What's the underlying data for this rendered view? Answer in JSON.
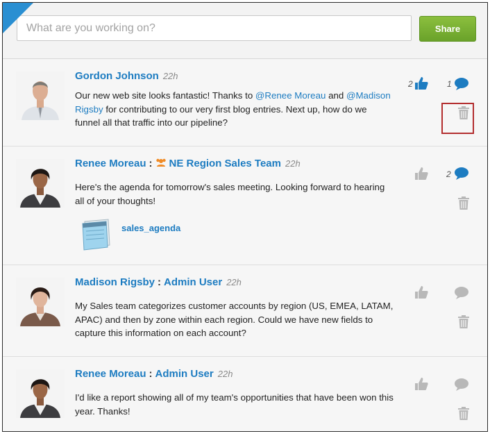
{
  "composer": {
    "placeholder": "What are you working on?",
    "share_label": "Share"
  },
  "posts": [
    {
      "author": "Gordon Johnson",
      "time": "22h",
      "group": "",
      "text_parts": [
        "Our new web site looks fantastic!  Thanks to ",
        "@Renee Moreau",
        " and ",
        "@Madison Rigsby",
        " for contributing to our very first blog entries.  Next up, how do we funnel all that traffic into our pipeline?"
      ],
      "likes": "2",
      "comments": "1"
    },
    {
      "author": "Renee Moreau",
      "time": "22h",
      "group": "NE Region Sales Team",
      "text": "Here's the agenda for tomorrow's sales meeting.  Looking forward to hearing all of your thoughts!",
      "attachment": "sales_agenda",
      "comments": "2"
    },
    {
      "author": "Madison Rigsby",
      "time": "22h",
      "group": "Admin User",
      "text": "My Sales team categorizes customer accounts by region (US, EMEA, LATAM, APAC) and then by zone within each region. Could we have new fields to capture this information on each account?"
    },
    {
      "author": "Renee Moreau",
      "time": "22h",
      "group": "Admin User",
      "text": "I'd like a report showing all of my team's opportunities that have been won this year.  Thanks!"
    }
  ],
  "colors": {
    "accent": "#1d7cc1",
    "share_green": "#78b032",
    "highlight_red": "#b32d2e",
    "icon_gray": "#b8b8b8"
  },
  "icons": {
    "like": "thumbs-up-icon",
    "comment": "speech-bubble-icon",
    "delete": "trash-icon",
    "group": "people-group-icon",
    "file": "notepad-file-icon"
  }
}
